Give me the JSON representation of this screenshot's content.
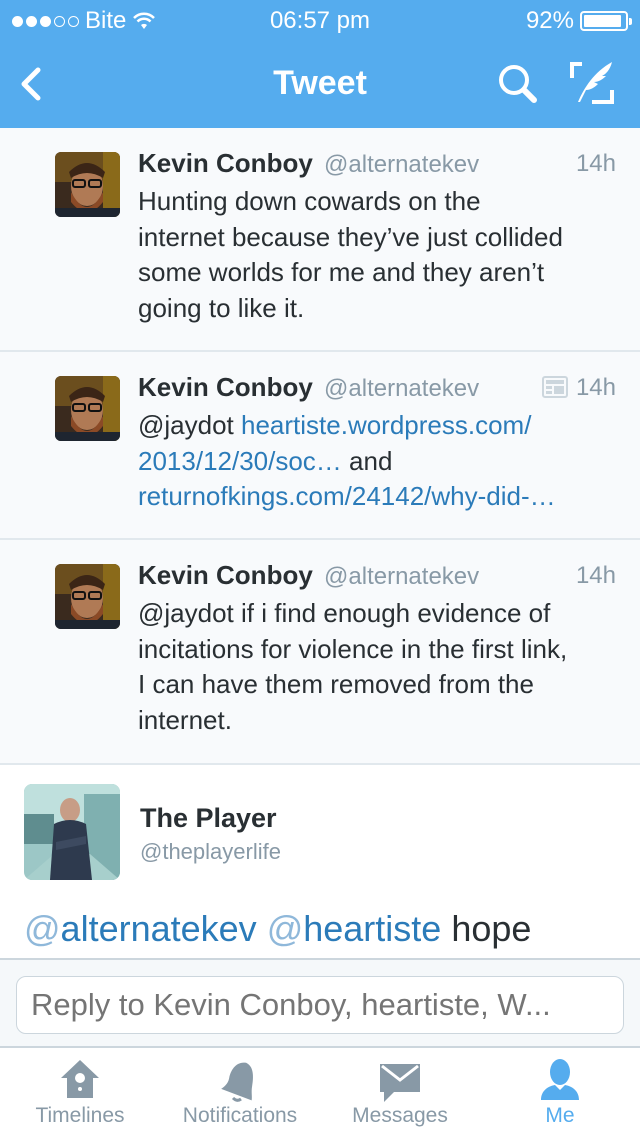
{
  "status_bar": {
    "carrier": "Bite",
    "signal_bars_filled": 3,
    "signal_bars_total": 5,
    "time": "06:57 pm",
    "battery_percent_label": "92%",
    "battery_level": 0.92
  },
  "nav": {
    "title": "Tweet",
    "back_icon": "chevron-left-icon",
    "search_icon": "search-icon",
    "compose_icon": "compose-quill-icon"
  },
  "colors": {
    "brand": "#55acee",
    "link": "#2b7bb9",
    "muted": "#8899a6",
    "text": "#292f33"
  },
  "conversation": [
    {
      "name": "Kevin Conboy",
      "handle": "@alternatekev",
      "time": "14h",
      "has_summary_icon": false,
      "lines": [
        [
          {
            "text": "Hunting down cowards on the",
            "link": false
          }
        ],
        [
          {
            "text": "internet because they’ve just collided",
            "link": false
          }
        ],
        [
          {
            "text": "some worlds for me and they aren’t",
            "link": false
          }
        ],
        [
          {
            "text": "going to like it.",
            "link": false
          }
        ]
      ]
    },
    {
      "name": "Kevin Conboy",
      "handle": "@alternatekev",
      "time": "14h",
      "has_summary_icon": true,
      "lines": [
        [
          {
            "text": "@jaydot ",
            "link": false
          },
          {
            "text": "heartiste.wordpress.com/",
            "link": true
          }
        ],
        [
          {
            "text": "2013/12/30/soc…",
            "link": true
          },
          {
            "text": " and",
            "link": false
          }
        ],
        [
          {
            "text": "returnofkings.com/24142/why-did-…",
            "link": true
          }
        ]
      ]
    },
    {
      "name": "Kevin Conboy",
      "handle": "@alternatekev",
      "time": "14h",
      "has_summary_icon": false,
      "lines": [
        [
          {
            "text": "@jaydot if i find enough evidence of",
            "link": false
          }
        ],
        [
          {
            "text": "incitations for violence in the first link,",
            "link": false
          }
        ],
        [
          {
            "text": "I can have them removed from the",
            "link": false
          }
        ],
        [
          {
            "text": "internet.",
            "link": false
          }
        ]
      ]
    }
  ],
  "main_tweet": {
    "name": "The Player",
    "handle": "@theplayerlife",
    "mention1_at": "@",
    "mention1": "alternatekev",
    "mention2_at": "@",
    "mention2": "heartiste",
    "text_tail": "hope"
  },
  "reply": {
    "placeholder": "Reply to Kevin Conboy, heartiste, W..."
  },
  "tabs": [
    {
      "label": "Timelines",
      "icon": "birdhouse-icon",
      "active": false
    },
    {
      "label": "Notifications",
      "icon": "bell-icon",
      "active": false
    },
    {
      "label": "Messages",
      "icon": "envelope-icon",
      "active": false
    },
    {
      "label": "Me",
      "icon": "person-icon",
      "active": true
    }
  ]
}
